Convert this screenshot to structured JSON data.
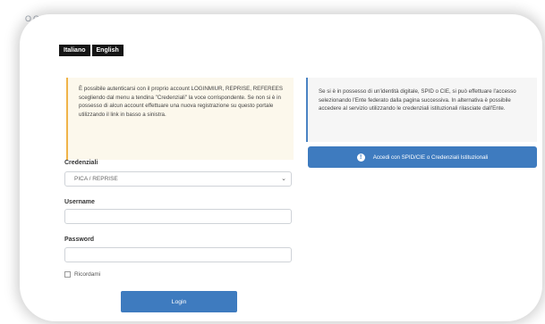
{
  "header": {
    "corner_text": "OGIN"
  },
  "language": {
    "buttons": [
      "Italiano",
      "English"
    ]
  },
  "info_left": {
    "text": "È possibile autenticarsi con il proprio account LOGINMIUR, REPRISE, REFEREES scegliendo dal menu a tendina \"Credenziali\" la voce corrispondente. Se non si è in possesso di alcun account effettuare una nuova registrazione su questo portale utilizzando il link in basso a sinistra."
  },
  "info_right": {
    "text": "Se si è in possesso di un'identità digitale, SPID o CIE, si può effettuare l'accesso selezionando l'Ente federato dalla pagina successiva. In alternativa è possibile accedere al servizio utilizzando le credenziali istituzionali rilasciate dall'Ente."
  },
  "spid_button": {
    "label": "Accedi con SPID/CIE o Credenziali Istituzionali",
    "icon": "info-icon"
  },
  "form": {
    "credentials_label": "Credenziali",
    "credentials_value": "PICA / REPRISE",
    "username_label": "Username",
    "username_value": "",
    "password_label": "Password",
    "password_value": "",
    "remember_label": "Ricordami",
    "login_label": "Login"
  },
  "colors": {
    "accent": "#3e7bbf",
    "warning_border": "#f0b449",
    "info_border": "#4b84c4",
    "warning_bg": "#fcf8ec"
  }
}
